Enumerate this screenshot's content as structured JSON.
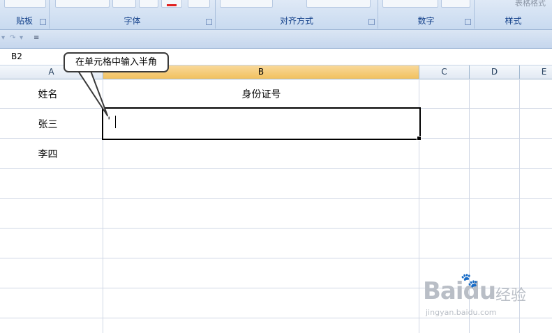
{
  "ribbon": {
    "groups": [
      {
        "label": "贴板"
      },
      {
        "label": "字体"
      },
      {
        "label": "对齐方式"
      },
      {
        "label": "数字"
      },
      {
        "label": "样式"
      }
    ],
    "styles_partial_label": "表格格式"
  },
  "namebox": {
    "value": "B2"
  },
  "columns": [
    "A",
    "B",
    "C",
    "D",
    "E"
  ],
  "active_column": "B",
  "cells": {
    "A1": "姓名",
    "B1": "身份证号",
    "A2": "张三",
    "A3": "李四",
    "B2_input": "'"
  },
  "callout": {
    "text": "在单元格中输入半角"
  },
  "watermark": {
    "logo": "Baidu",
    "cn": "经验",
    "url": "jingyan.baidu.com"
  },
  "colors": {
    "selection_border": "#000000",
    "active_header": "#f1c15f",
    "ribbon_text": "#15428b"
  }
}
